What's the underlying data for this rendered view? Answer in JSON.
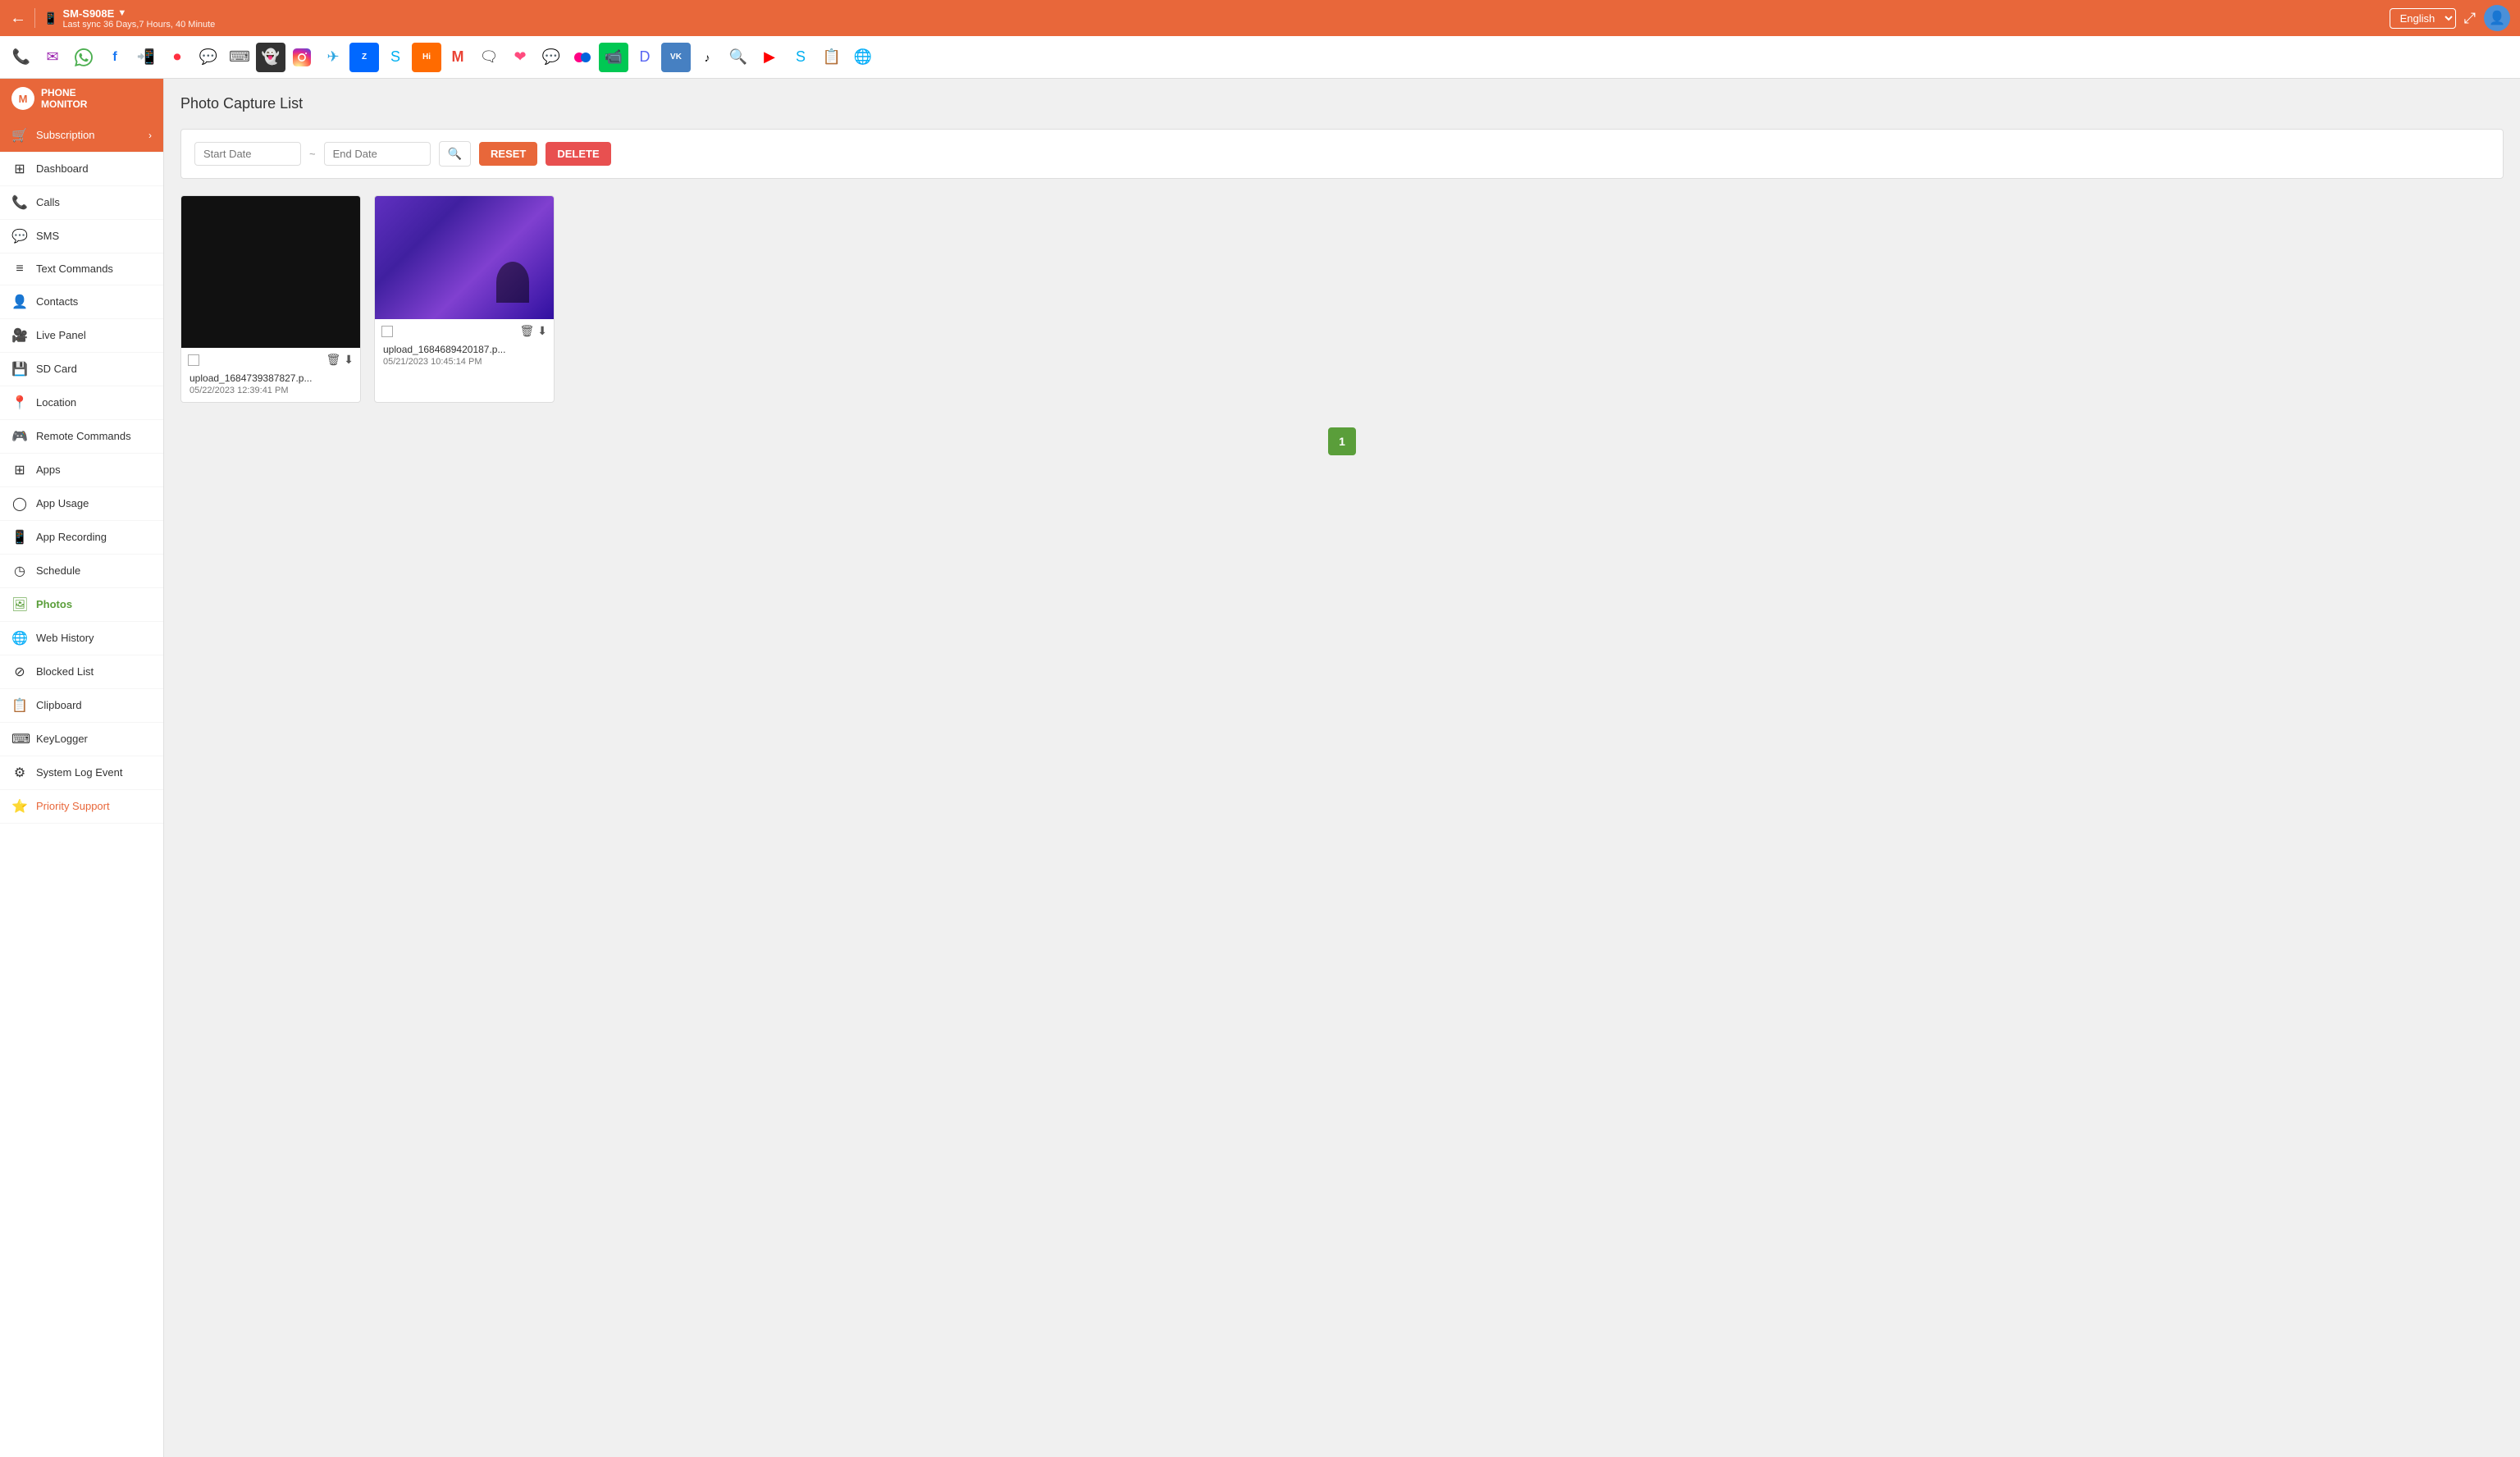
{
  "topbar": {
    "back_label": "←",
    "device_name": "SM-S908E",
    "device_name_arrow": "▼",
    "last_sync": "Last sync 36 Days,7 Hours, 40 Minute",
    "language": "English",
    "fullscreen_icon": "⤢",
    "avatar_icon": "👤"
  },
  "iconbar": {
    "icons": [
      {
        "name": "phone-icon",
        "symbol": "📞",
        "label": "Phone"
      },
      {
        "name": "email-icon",
        "symbol": "✉",
        "label": "Email"
      },
      {
        "name": "whatsapp-icon",
        "symbol": "💬",
        "label": "WhatsApp"
      },
      {
        "name": "facebook-icon",
        "symbol": "f",
        "label": "Facebook"
      },
      {
        "name": "viber-icon",
        "symbol": "📲",
        "label": "Viber"
      },
      {
        "name": "tiktok2-icon",
        "symbol": "🔴",
        "label": "TikTok2"
      },
      {
        "name": "wechat-icon",
        "symbol": "💬",
        "label": "WeChat"
      },
      {
        "name": "keyboard-icon",
        "symbol": "⌨",
        "label": "Keyboard"
      },
      {
        "name": "snapchat-icon",
        "symbol": "👻",
        "label": "Snapchat"
      },
      {
        "name": "instagram-icon",
        "symbol": "📷",
        "label": "Instagram"
      },
      {
        "name": "telegram-icon",
        "symbol": "✈",
        "label": "Telegram"
      },
      {
        "name": "zalo-icon",
        "symbol": "Z",
        "label": "Zalo"
      },
      {
        "name": "skype2-icon",
        "symbol": "S",
        "label": "Skype2"
      },
      {
        "name": "hiapp-icon",
        "symbol": "Hi",
        "label": "HiApp"
      },
      {
        "name": "gmail-icon",
        "symbol": "M",
        "label": "Gmail"
      },
      {
        "name": "bbm-icon",
        "symbol": "🗨",
        "label": "BBM"
      },
      {
        "name": "badoo-icon",
        "symbol": "B",
        "label": "Badoo"
      },
      {
        "name": "hangouts-icon",
        "symbol": "H",
        "label": "Hangouts"
      },
      {
        "name": "flickr-icon",
        "symbol": "●",
        "label": "Flickr"
      },
      {
        "name": "facetime-icon",
        "symbol": "📹",
        "label": "FaceTime"
      },
      {
        "name": "discord-icon",
        "symbol": "D",
        "label": "Discord"
      },
      {
        "name": "vk-icon",
        "symbol": "VK",
        "label": "VK"
      },
      {
        "name": "tiktok-icon",
        "symbol": "♪",
        "label": "TikTok"
      },
      {
        "name": "qsearch-icon",
        "symbol": "🔍",
        "label": "Search"
      },
      {
        "name": "youtube-icon",
        "symbol": "▶",
        "label": "YouTube"
      },
      {
        "name": "skype-icon",
        "symbol": "S",
        "label": "Skype"
      },
      {
        "name": "notes-icon",
        "symbol": "📋",
        "label": "Notes"
      },
      {
        "name": "browser-icon",
        "symbol": "🌐",
        "label": "Browser"
      }
    ]
  },
  "sidebar": {
    "logo_letter": "M",
    "logo_text_line1": "PHONE",
    "logo_text_line2": "MONITOR",
    "items": [
      {
        "key": "subscription",
        "label": "Subscription",
        "icon": "🛒",
        "active": false,
        "subscription": true,
        "arrow": "›"
      },
      {
        "key": "dashboard",
        "label": "Dashboard",
        "icon": "⊞",
        "active": false
      },
      {
        "key": "calls",
        "label": "Calls",
        "icon": "📞",
        "active": false
      },
      {
        "key": "sms",
        "label": "SMS",
        "icon": "💬",
        "active": false
      },
      {
        "key": "text-commands",
        "label": "Text Commands",
        "icon": "≡",
        "active": false
      },
      {
        "key": "contacts",
        "label": "Contacts",
        "icon": "👤",
        "active": false
      },
      {
        "key": "live-panel",
        "label": "Live Panel",
        "icon": "🎥",
        "active": false
      },
      {
        "key": "sd-card",
        "label": "SD Card",
        "icon": "💾",
        "active": false
      },
      {
        "key": "location",
        "label": "Location",
        "icon": "📍",
        "active": false
      },
      {
        "key": "remote-commands",
        "label": "Remote Commands",
        "icon": "🎮",
        "active": false
      },
      {
        "key": "apps",
        "label": "Apps",
        "icon": "⊞",
        "active": false
      },
      {
        "key": "app-usage",
        "label": "App Usage",
        "icon": "◯",
        "active": false
      },
      {
        "key": "app-recording",
        "label": "App Recording",
        "icon": "📱",
        "active": false
      },
      {
        "key": "schedule",
        "label": "Schedule",
        "icon": "◷",
        "active": false
      },
      {
        "key": "photos",
        "label": "Photos",
        "icon": "🖼",
        "active": true
      },
      {
        "key": "web-history",
        "label": "Web History",
        "icon": "🌐",
        "active": false
      },
      {
        "key": "blocked-list",
        "label": "Blocked List",
        "icon": "⊘",
        "active": false
      },
      {
        "key": "clipboard",
        "label": "Clipboard",
        "icon": "📋",
        "active": false
      },
      {
        "key": "keylogger",
        "label": "KeyLogger",
        "icon": "⌨",
        "active": false
      },
      {
        "key": "system-log",
        "label": "System Log Event",
        "icon": "⚙",
        "active": false
      },
      {
        "key": "priority-support",
        "label": "Priority Support",
        "icon": "⭐",
        "active": false,
        "priority": true
      }
    ]
  },
  "content": {
    "page_title": "Photo Capture List",
    "filter": {
      "start_date_placeholder": "Start Date",
      "end_date_placeholder": "End Date",
      "separator": "~",
      "search_icon": "🔍",
      "reset_label": "RESET",
      "delete_label": "DELETE"
    },
    "photos": [
      {
        "id": "photo1",
        "type": "black",
        "filename": "upload_1684739387827.p...",
        "date": "05/22/2023 12:39:41 PM"
      },
      {
        "id": "photo2",
        "type": "purple",
        "filename": "upload_1684689420187.p...",
        "date": "05/21/2023 10:45:14 PM"
      }
    ],
    "pagination": {
      "current_page": "1"
    }
  }
}
